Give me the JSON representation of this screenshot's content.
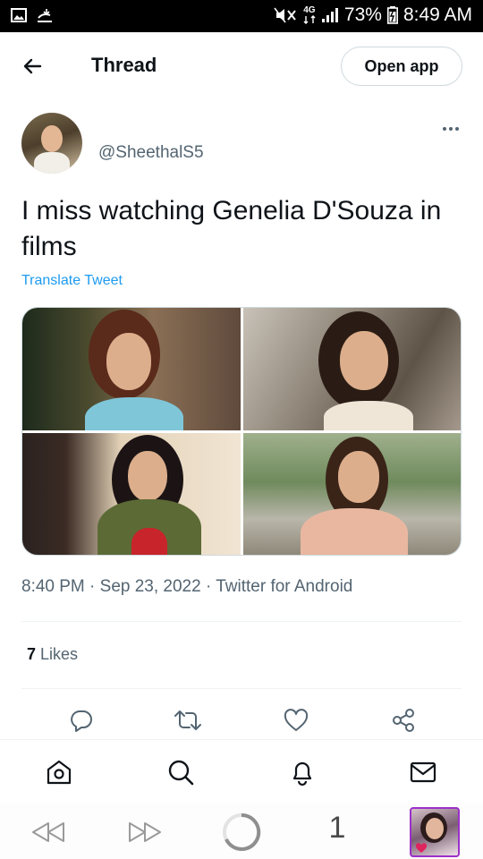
{
  "status_bar": {
    "signal_label": "4G",
    "battery_percent": "73%",
    "time": "8:49 AM",
    "icons": [
      "image-icon",
      "download-notification-icon",
      "mute-icon",
      "network-icon",
      "signal-bars-icon",
      "battery-icon"
    ]
  },
  "header": {
    "back_icon": "arrow-left-icon",
    "title": "Thread",
    "open_app_label": "Open app"
  },
  "tweet": {
    "handle": "@SheethalS5",
    "text": "I miss watching Genelia D'Souza in films",
    "translate_label": "Translate Tweet",
    "timestamp": "8:40 PM · Sep 23, 2022 · Twitter for Android",
    "likes_count": "7",
    "likes_label": "Likes",
    "photos": [
      "photo-1",
      "photo-2",
      "photo-3",
      "photo-4"
    ]
  },
  "actions": [
    "reply-icon",
    "retweet-icon",
    "like-icon",
    "share-icon"
  ],
  "bottom_nav": [
    "home-icon",
    "search-icon",
    "notifications-icon",
    "messages-icon"
  ],
  "browser_bar": {
    "tab_count": "1",
    "icons": [
      "back-icon",
      "forward-icon",
      "reload-icon"
    ]
  },
  "colors": {
    "accent": "#1d9bf0",
    "text_primary": "#0f1419",
    "text_secondary": "#536471",
    "profile_border": "#9b30c9"
  }
}
